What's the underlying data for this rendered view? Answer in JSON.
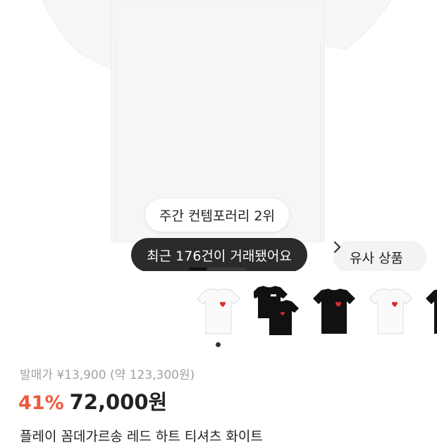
{
  "badges": {
    "rank": "주간 컨템포러리 2위",
    "trades": "최근 176건이 거래됐어요"
  },
  "similar_button": {
    "label": "유사 상품",
    "icon": "chevron-right-icon"
  },
  "thumbnails": [
    {
      "name": "white-tee-red-heart",
      "shirt_color": "#ffffff"
    },
    {
      "name": "black-tee-two-pack",
      "shirt_color": "#111111"
    },
    {
      "name": "black-tee-red-heart",
      "shirt_color": "#111111"
    },
    {
      "name": "white-tee-red-heart-2",
      "shirt_color": "#ffffff"
    },
    {
      "name": "black-tee-partial",
      "shirt_color": "#111111"
    }
  ],
  "gallery": {
    "current_page": 1
  },
  "price": {
    "release_label": "발매가 ¥13,900 (약 123,300원)",
    "discount": "41%",
    "current": "72,000원"
  },
  "product": {
    "title": "플레이 꼼데가르송 레드 하트 티셔츠 화이트"
  },
  "colors": {
    "discount": "#ef5a3c",
    "dark_pill": "#2b2b2b",
    "heart": "#d62a2a"
  }
}
